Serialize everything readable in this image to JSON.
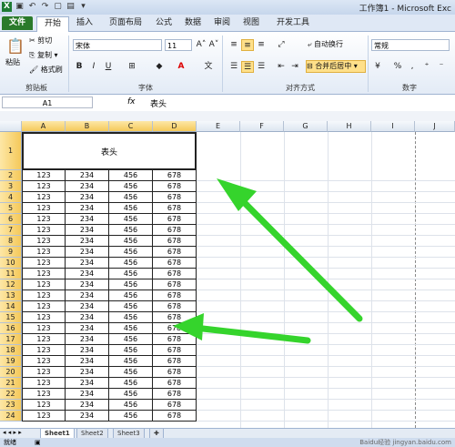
{
  "window": {
    "title": "工作簿1 - Microsoft Exc"
  },
  "ribbon_tabs": [
    "文件",
    "开始",
    "插入",
    "页面布局",
    "公式",
    "数据",
    "审阅",
    "视图",
    "开发工具"
  ],
  "clipboard": {
    "paste": "粘贴",
    "cut": "剪切",
    "copy": "复制 ▾",
    "format_painter": "格式刷",
    "group": "剪贴板"
  },
  "font": {
    "name": "宋体",
    "size": "11",
    "bold": "B",
    "italic": "I",
    "underline": "U",
    "grow": "A˄",
    "shrink": "A˅",
    "color_a": "A",
    "group": "字体"
  },
  "alignment": {
    "wrap": "自动换行",
    "merge": "合并后居中 ▾",
    "group": "对齐方式"
  },
  "number": {
    "format": "常规",
    "percent": "%",
    "comma": ",",
    "group": "数字"
  },
  "formula_bar": {
    "name_box": "A1",
    "fx": "fx",
    "content": "表头"
  },
  "columns": [
    "A",
    "B",
    "C",
    "D",
    "E",
    "F",
    "G",
    "H",
    "I",
    "J"
  ],
  "header_cell": "表头",
  "row_numbers": [
    "1",
    "2",
    "3",
    "4",
    "5",
    "6",
    "7",
    "8",
    "9",
    "10",
    "11",
    "12",
    "13",
    "14",
    "15",
    "16",
    "17",
    "18",
    "19",
    "20",
    "21",
    "22",
    "23",
    "24"
  ],
  "row_values": [
    "123",
    "234",
    "456",
    "678"
  ],
  "sheets": [
    "Sheet1",
    "Sheet2",
    "Sheet3"
  ],
  "status": "就绪",
  "watermark": "Baidu经验 jingyan.baidu.com",
  "annotation_color": "#35d42c"
}
